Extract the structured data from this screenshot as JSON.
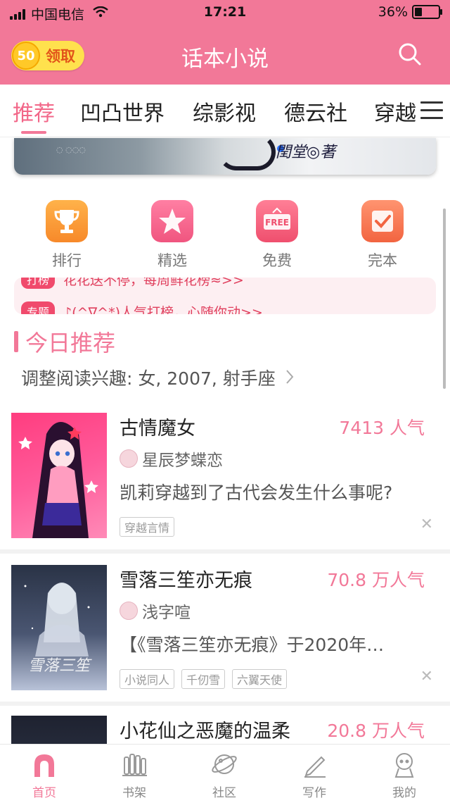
{
  "status_bar": {
    "carrier": "中国电信",
    "time": "17:21",
    "battery": "36%",
    "battery_level": 0.36
  },
  "header": {
    "coin_count": "50",
    "claim_label": "领取",
    "title": "话本小说"
  },
  "tabs": [
    {
      "label": "推荐"
    },
    {
      "label": "凹凸世界"
    },
    {
      "label": "综影视"
    },
    {
      "label": "德云社"
    },
    {
      "label": "穿越"
    }
  ],
  "banner": {
    "author_text": "閏堂◎著"
  },
  "quick_links": [
    {
      "label": "排行",
      "icon": "trophy-icon"
    },
    {
      "label": "精选",
      "icon": "star-icon"
    },
    {
      "label": "免费",
      "icon": "free-icon",
      "icon_text": "FREE"
    },
    {
      "label": "完本",
      "icon": "check-icon"
    }
  ],
  "ticker": [
    {
      "tag": "打榜",
      "text": "花花送不停，每周鲜花榜≈>>"
    },
    {
      "tag": "专题",
      "text": "♪(^∇^*)人气打榜，心随你动>>"
    }
  ],
  "section": {
    "title": "今日推荐",
    "interest_text": "调整阅读兴趣: 女, 2007, 射手座"
  },
  "books": [
    {
      "title": "古情魔女",
      "popularity": "7413 人气",
      "author": "星辰梦蝶恋",
      "desc": "凯莉穿越到了古代会发生什么事呢?",
      "tags": [
        "穿越言情"
      ]
    },
    {
      "title": "雪落三笙亦无痕",
      "popularity": "70.8 万人气",
      "author": "浅字喧",
      "desc": "【《雪落三笙亦无痕》于2020年…",
      "tags": [
        "小说同人",
        "千仞雪",
        "六翼天使"
      ],
      "cover_text": "雪落三笙"
    },
    {
      "title": "小花仙之恶魔的温柔",
      "popularity": "20.8 万人气"
    }
  ],
  "bottom_nav": [
    {
      "label": "首页"
    },
    {
      "label": "书架"
    },
    {
      "label": "社区"
    },
    {
      "label": "写作"
    },
    {
      "label": "我的"
    }
  ],
  "colors": {
    "brand": "#f27898",
    "accent_text": "#f26688",
    "coin": "#ffc928"
  }
}
